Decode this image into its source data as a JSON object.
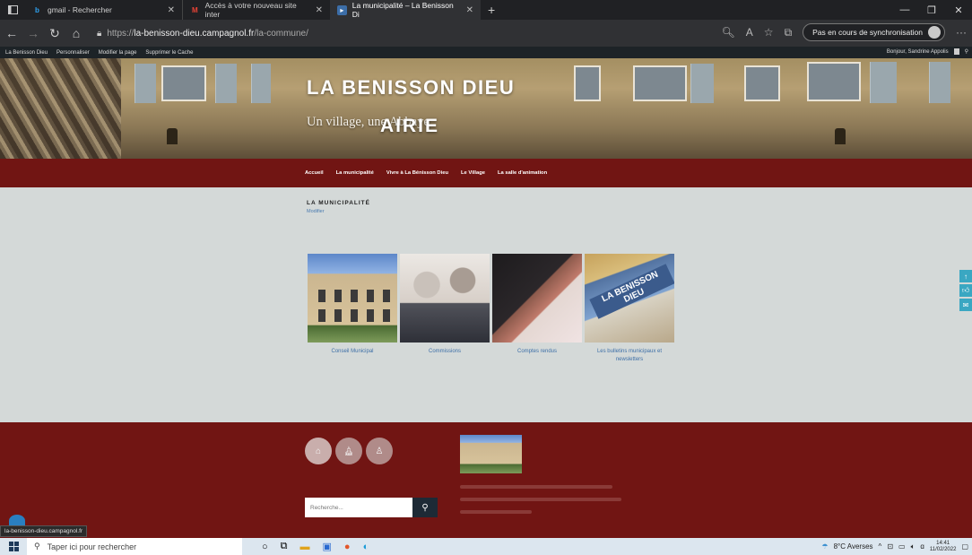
{
  "browser": {
    "tabs": [
      {
        "title": "gmail - Rechercher",
        "icon": "bing-icon"
      },
      {
        "title": "Accès à votre nouveau site inter",
        "icon": "gmail-icon"
      },
      {
        "title": "La municipalité – La Benisson Di",
        "icon": "site-icon"
      }
    ],
    "url_prefix": "https://",
    "url_domain": "la-benisson-dieu.campagnol.fr",
    "url_path": "/la-commune/",
    "sync_label": "Pas en cours de synchronisation"
  },
  "wp_admin": {
    "items": [
      "La Benisson Dieu",
      "Personnaliser",
      "Modifier la page",
      "Supprimer le Cache"
    ],
    "greeting": "Bonjour, Sandrine Appolis"
  },
  "site": {
    "title": "LA BENISSON DIEU",
    "tagline": "Un village, une Abbaye",
    "banner_text": "AIRIE",
    "nav": [
      "Accueil",
      "La municipalité",
      "Vivre à La Bénisson Dieu",
      "Le Village",
      "La salle d'animation"
    ]
  },
  "content": {
    "heading": "LA MUNICIPALITÉ",
    "edit_link": "Modifier",
    "cards": [
      {
        "caption": "Conseil Municipal"
      },
      {
        "caption": "Commissions"
      },
      {
        "caption": "Comptes rendus"
      },
      {
        "caption": "Les bulletins municipaux et newsletters"
      }
    ],
    "bulletin_label": "LA BENISSON DIEU"
  },
  "footer": {
    "search_placeholder": "Recherche...",
    "hover_url": "la-benisson-dieu.campagnol.fr"
  },
  "taskbar": {
    "search_placeholder": "Taper ici pour rechercher",
    "weather": "8°C Averses",
    "time": "14:41",
    "date": "11/02/2022"
  }
}
